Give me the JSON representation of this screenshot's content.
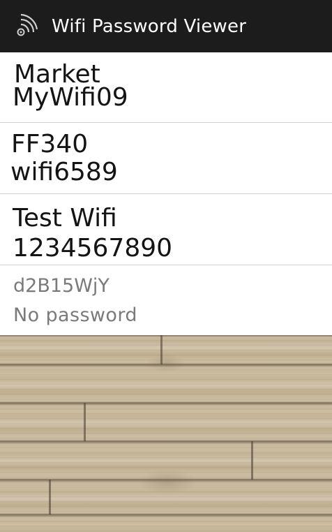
{
  "app": {
    "title": "Wifi Password Viewer",
    "icon": "wifi-icon"
  },
  "networks": [
    {
      "ssid": "Market",
      "password": "MyWifi09"
    },
    {
      "ssid": "FF340",
      "password": "wifi6589"
    },
    {
      "ssid": "Test Wifi",
      "password": "1234567890"
    },
    {
      "ssid": "d2B15WjY",
      "password": "No password"
    }
  ],
  "colors": {
    "actionbar": "#1c1c1c",
    "title_text": "#ffffff",
    "primary_text": "#141414",
    "secondary_text": "#7a7a7a",
    "divider": "#cfcfcf",
    "background": "wood-texture"
  }
}
